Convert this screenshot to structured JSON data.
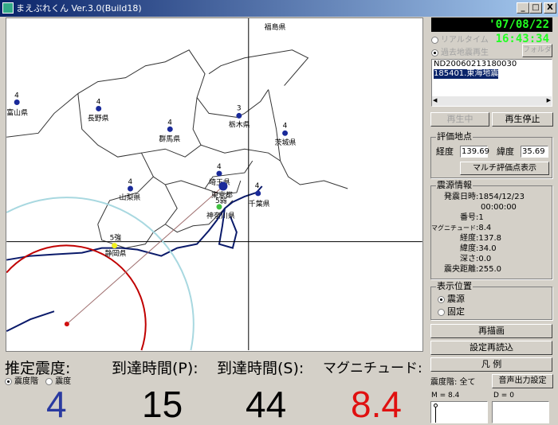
{
  "window": {
    "title": "まえぶれくん Ver.3.0(Build18)",
    "minimize": "_",
    "maximize": "□",
    "close": "X"
  },
  "map": {
    "prefectures": [
      {
        "name": "福島県",
        "intensity": ""
      },
      {
        "name": "富山県",
        "intensity": "4"
      },
      {
        "name": "長野県",
        "intensity": "4"
      },
      {
        "name": "栃木県",
        "intensity": "3"
      },
      {
        "name": "群馬県",
        "intensity": "4"
      },
      {
        "name": "茨城県",
        "intensity": "4"
      },
      {
        "name": "埼玉県",
        "intensity": "4"
      },
      {
        "name": "東京都",
        "intensity": ""
      },
      {
        "name": "山梨県",
        "intensity": "4"
      },
      {
        "name": "千葉県",
        "intensity": "4"
      },
      {
        "name": "神奈川県",
        "intensity": "5弱"
      },
      {
        "name": "静岡県",
        "intensity": "5強"
      }
    ],
    "colors": {
      "station": "#1a2a9a",
      "epicenter": "#d01010",
      "p_wave": "#c00000",
      "s_wave": "#a8d8e0",
      "yellow": "#f0f020",
      "green": "#40c040"
    }
  },
  "bottom": {
    "intensity_label": "推定震度:",
    "p_label": "到達時間(P):",
    "s_label": "到達時間(S):",
    "mag_label": "マグニチュード:",
    "radio_scale": "震度階",
    "radio_intensity": "震度",
    "intensity_value": "4",
    "p_value": "15",
    "s_value": "44",
    "mag_value": "8.4",
    "colors": {
      "intensity": "#2a3aa0",
      "mag": "#e01010"
    }
  },
  "side": {
    "clock": "'07/08/22 16:43:34",
    "realtime": "リアルタイム",
    "playback": "過去地震再生",
    "folder": "フォルダ",
    "list": [
      "ND20060213180030",
      "185401.東海地震"
    ],
    "playing": "再生中",
    "stop": "再生停止",
    "eval_title": "評価地点",
    "lon_label": "経度",
    "lon": "139.69",
    "lat_label": "緯度",
    "lat": "35.69",
    "multi": "マルチ評価点表示",
    "src_title": "震源情報",
    "src": [
      {
        "k": "発震日時",
        "v": ":1854/12/23"
      },
      {
        "k": "",
        "v": "00:00:00"
      },
      {
        "k": "番号",
        "v": ":1"
      },
      {
        "k": "マグニチュード",
        "v": ":8.4"
      },
      {
        "k": "経度",
        "v": ":137.8"
      },
      {
        "k": "緯度",
        "v": ":34.0"
      },
      {
        "k": "深さ",
        "v": ":0.0"
      },
      {
        "k": "震央距離",
        "v": ":255.0"
      }
    ],
    "pos_title": "表示位置",
    "pos_src": "震源",
    "pos_fixed": "固定",
    "redraw": "再描画",
    "reload": "設定再読込",
    "legend": "凡 例",
    "scale_label": "震度階: 全て",
    "audio": "音声出力設定",
    "m_label": "M = 8.4",
    "d_label": "D = 0"
  }
}
